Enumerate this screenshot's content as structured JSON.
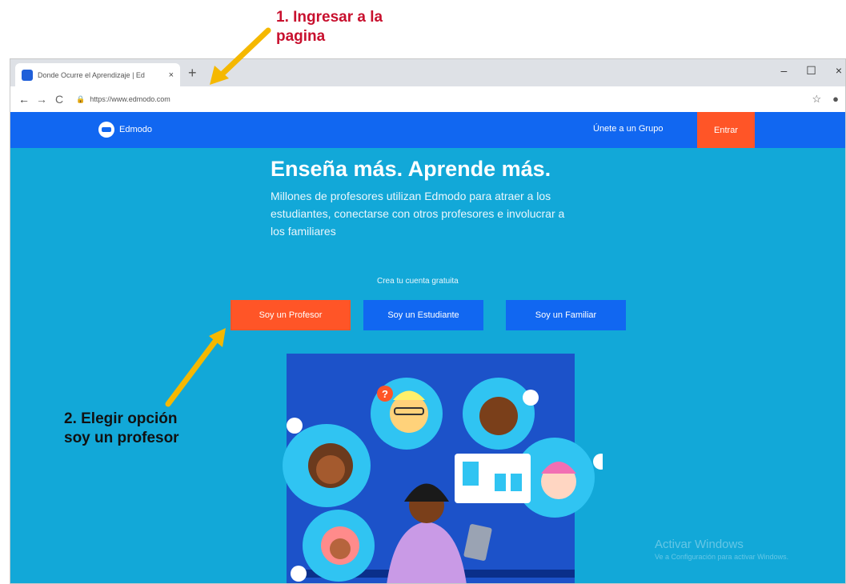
{
  "annotations": {
    "step1_line1": "1. Ingresar a la",
    "step1_line2": "pagina",
    "step2_line1": "2. Elegir opción",
    "step2_line2": "soy un profesor"
  },
  "browser": {
    "tab_title": "Donde Ocurre el Aprendizaje | Ed",
    "tab_close": "×",
    "new_tab": "+",
    "url": "https://www.edmodo.com",
    "window_controls": [
      "–",
      "☐",
      "×"
    ]
  },
  "site": {
    "brand": "Edmodo",
    "nav_join": "Únete a un Grupo",
    "nav_login": "Entrar",
    "hero_title": "Enseña más. Aprende más.",
    "hero_subtitle": "Millones de profesores utilizan Edmodo para atraer a los estudiantes, conectarse con otros profesores e involucrar a los familiares",
    "cta_caption": "Crea tu cuenta gratuita",
    "buttons": {
      "teacher": "Soy un Profesor",
      "student": "Soy un Estudiante",
      "parent": "Soy un Familiar"
    },
    "watermark_title": "Activar Windows",
    "watermark_sub": "Ve a Configuración para activar Windows."
  },
  "colors": {
    "accent_orange": "#ff5527",
    "nav_blue": "#1167f1",
    "hero_bg": "#12a8d8",
    "annotation_red": "#c8102e",
    "arrow_yellow": "#f5b800"
  }
}
